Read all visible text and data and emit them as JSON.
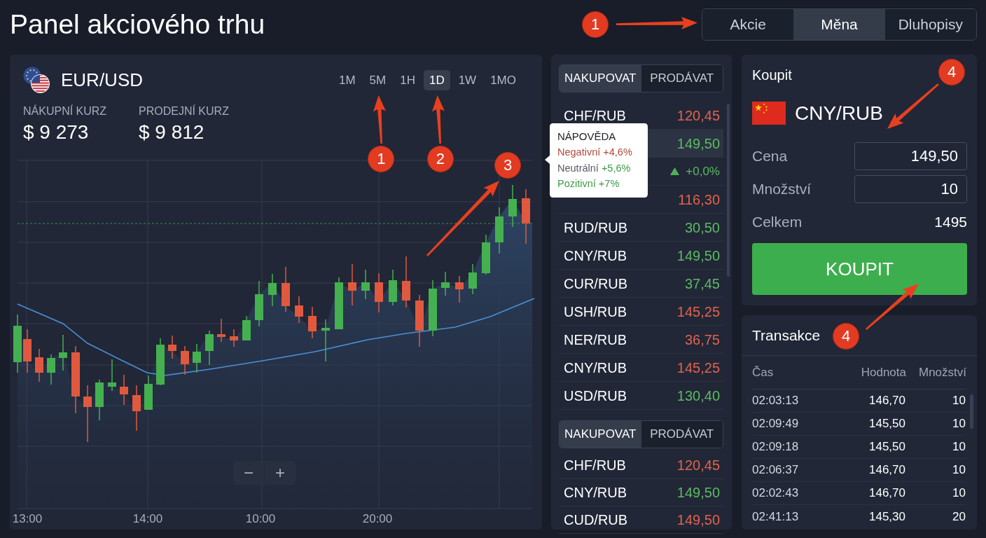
{
  "page_title": "Panel akciového trhu",
  "market_tabs": {
    "callout": "1",
    "items": [
      {
        "label": "Akcie",
        "selected": false
      },
      {
        "label": "Měna",
        "selected": true
      },
      {
        "label": "Dluhopisy",
        "selected": false
      }
    ]
  },
  "chart_panel": {
    "pair": "EUR/USD",
    "timeframes": [
      {
        "label": "1M",
        "selected": false
      },
      {
        "label": "5M",
        "selected": false,
        "callout": "1"
      },
      {
        "label": "1H",
        "selected": false
      },
      {
        "label": "1D",
        "selected": true,
        "callout": "2"
      },
      {
        "label": "1W",
        "selected": false
      },
      {
        "label": "1MO",
        "selected": false
      }
    ],
    "quotes": [
      {
        "label": "NÁKUPNÍ KURZ",
        "value": "$ 9 273"
      },
      {
        "label": "PRODEJNÍ KURZ",
        "value": "$ 9 812"
      }
    ],
    "chart": {
      "callout": "3",
      "x_labels": [
        "13:00",
        "14:00",
        "10:00",
        "20:00"
      ],
      "zoom_buttons": [
        "−",
        "+"
      ]
    }
  },
  "rates_panel": {
    "lists": [
      {
        "tabs": [
          {
            "label": "NAKUPOVAT",
            "selected": true
          },
          {
            "label": "PRODÁVAT",
            "selected": false
          }
        ],
        "rows": [
          {
            "kind": "price",
            "pair": "CHF/RUB",
            "value": "120,45",
            "rising": false,
            "selected": false
          },
          {
            "kind": "price",
            "value": "149,50",
            "rising": true,
            "selected": true
          },
          {
            "kind": "change",
            "value": "+0,0%",
            "rising": true,
            "selected": false
          },
          {
            "kind": "price",
            "value": "116,30",
            "rising": false,
            "selected": false
          },
          {
            "kind": "price",
            "pair": "RUD/RUB",
            "value": "30,50",
            "rising": true,
            "selected": false
          },
          {
            "kind": "price",
            "pair": "CNY/RUB",
            "value": "149,50",
            "rising": true,
            "selected": false
          },
          {
            "kind": "price",
            "pair": "CUR/RUB",
            "value": "37,45",
            "rising": true,
            "selected": false
          },
          {
            "kind": "price",
            "pair": "USH/RUB",
            "value": "145,25",
            "rising": false,
            "selected": false
          },
          {
            "kind": "price",
            "pair": "NER/RUB",
            "value": "36,75",
            "rising": false,
            "selected": false
          },
          {
            "kind": "price",
            "pair": "CNY/RUB",
            "value": "145,25",
            "rising": false,
            "selected": false
          },
          {
            "kind": "price",
            "pair": "USD/RUB",
            "value": "130,40",
            "rising": true,
            "selected": false
          }
        ]
      },
      {
        "tabs": [
          {
            "label": "NAKUPOVAT",
            "selected": true
          },
          {
            "label": "PRODÁVAT",
            "selected": false
          }
        ],
        "rows": [
          {
            "kind": "price",
            "pair": "CHF/RUB",
            "value": "120,45",
            "rising": false,
            "selected": false
          },
          {
            "kind": "price",
            "pair": "CNY/RUB",
            "value": "149,50",
            "rising": true,
            "selected": false
          },
          {
            "kind": "price",
            "pair": "CUD/RUB",
            "value": "149,50",
            "rising": false,
            "selected": false
          }
        ]
      }
    ]
  },
  "tooltip": {
    "title": "NÁPOVĚDA",
    "lines": [
      {
        "kind": "negative",
        "label": "Negativní",
        "value": "+4,6%"
      },
      {
        "kind": "neutral",
        "label": "Neutrální",
        "value": "+5,6%"
      },
      {
        "kind": "positive",
        "label": "Pozitivní",
        "value": "+7%"
      }
    ]
  },
  "buy_panel": {
    "title": "Koupit",
    "pair": "CNY/RUB",
    "pair_callout": "4",
    "fields": [
      {
        "label": "Cena",
        "value": "149,50"
      },
      {
        "label": "Množství",
        "value": "10"
      }
    ],
    "total_label": "Celkem",
    "total": "1495",
    "button": "KOUPIT"
  },
  "transactions": {
    "title": "Transakce",
    "callout": "4",
    "columns": [
      "Čas",
      "Hodnota",
      "Množství"
    ],
    "rows": [
      [
        "02:03:13",
        "146,70",
        "10"
      ],
      [
        "02:09:49",
        "145,50",
        "10"
      ],
      [
        "02:09:18",
        "145,50",
        "10"
      ],
      [
        "02:06:37",
        "146,70",
        "10"
      ],
      [
        "02:02:43",
        "146,70",
        "10"
      ],
      [
        "02:41:13",
        "145,30",
        "20"
      ]
    ]
  }
}
